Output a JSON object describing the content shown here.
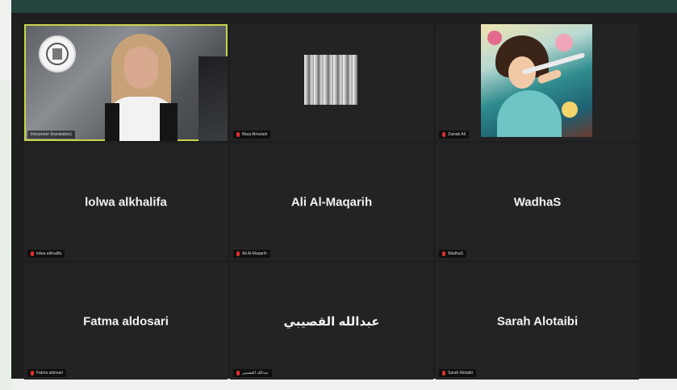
{
  "window": {
    "accent": "#c8d34a",
    "mic_muted_color": "#e0302d"
  },
  "participants": [
    {
      "tile_type": "video",
      "label": "Interpreter (translation)",
      "active": true
    },
    {
      "tile_type": "video",
      "label": "Maqi Almutairi"
    },
    {
      "tile_type": "video",
      "label": "Zainab Ali"
    },
    {
      "tile_type": "name",
      "display_name": "lolwa alkhalifa",
      "label": "lolwa alkhalifa"
    },
    {
      "tile_type": "name",
      "display_name": "Ali Al-Maqarih",
      "label": "Ali Al-Maqarih"
    },
    {
      "tile_type": "name",
      "display_name": "WadhaS",
      "label": "WadhaS"
    },
    {
      "tile_type": "name",
      "display_name": "Fatma aldosari",
      "label": "Fatma aldosari"
    },
    {
      "tile_type": "name",
      "display_name": "عبدالله القصيبي",
      "label": "عبدالله القصيبي"
    },
    {
      "tile_type": "name",
      "display_name": "Sarah Alotaibi",
      "label": "Sarah Alotaibi"
    }
  ]
}
